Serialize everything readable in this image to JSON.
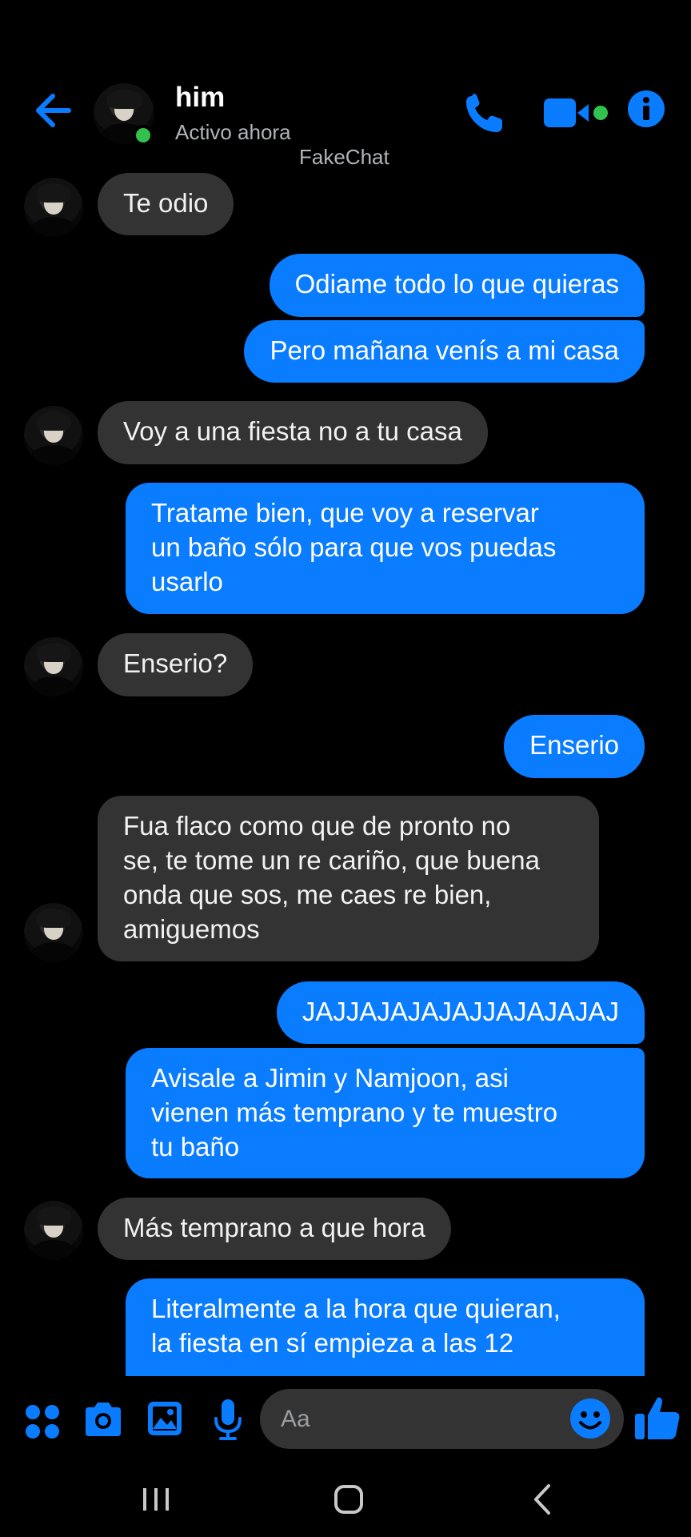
{
  "header": {
    "name": "him",
    "status": "Activo ahora",
    "watermark": "FakeChat"
  },
  "colors": {
    "accent": "#0a7cff",
    "incoming_bubble": "#333334",
    "online": "#31c24d",
    "background": "#000000"
  },
  "messages": [
    {
      "from": "them",
      "text": "Te odio"
    },
    {
      "from": "me",
      "text": "Odiame todo lo que quieras"
    },
    {
      "from": "me",
      "text": "Pero mañana venís a mi casa"
    },
    {
      "from": "them",
      "text": "Voy a una fiesta no a tu casa"
    },
    {
      "from": "me",
      "text": "Tratame bien, que voy a reservar\nun baño sólo para que vos puedas\nusarlo"
    },
    {
      "from": "them",
      "text": "Enserio?"
    },
    {
      "from": "me",
      "text": "Enserio"
    },
    {
      "from": "them",
      "text": "Fua flaco como que de pronto no\nse, te tome un re cariño, que buena\nonda que sos, me caes re bien,\namiguemos"
    },
    {
      "from": "me",
      "text": "JAJJAJAJAJAJJAJAJAJAJ"
    },
    {
      "from": "me",
      "text": "Avisale a Jimin y Namjoon, asi\nvienen más temprano y te muestro\ntu baño"
    },
    {
      "from": "them",
      "text": "Más temprano a que hora"
    },
    {
      "from": "me",
      "text": "Literalmente a la hora que quieran,\nla fiesta en sí empieza a las 12"
    }
  ],
  "composer": {
    "placeholder": "Aa",
    "icons": [
      "apps-icon",
      "camera-icon",
      "gallery-icon",
      "microphone-icon",
      "emoji-icon",
      "like-icon"
    ]
  },
  "navbar": {
    "icons": [
      "recent-apps-icon",
      "home-icon",
      "back-icon"
    ]
  }
}
